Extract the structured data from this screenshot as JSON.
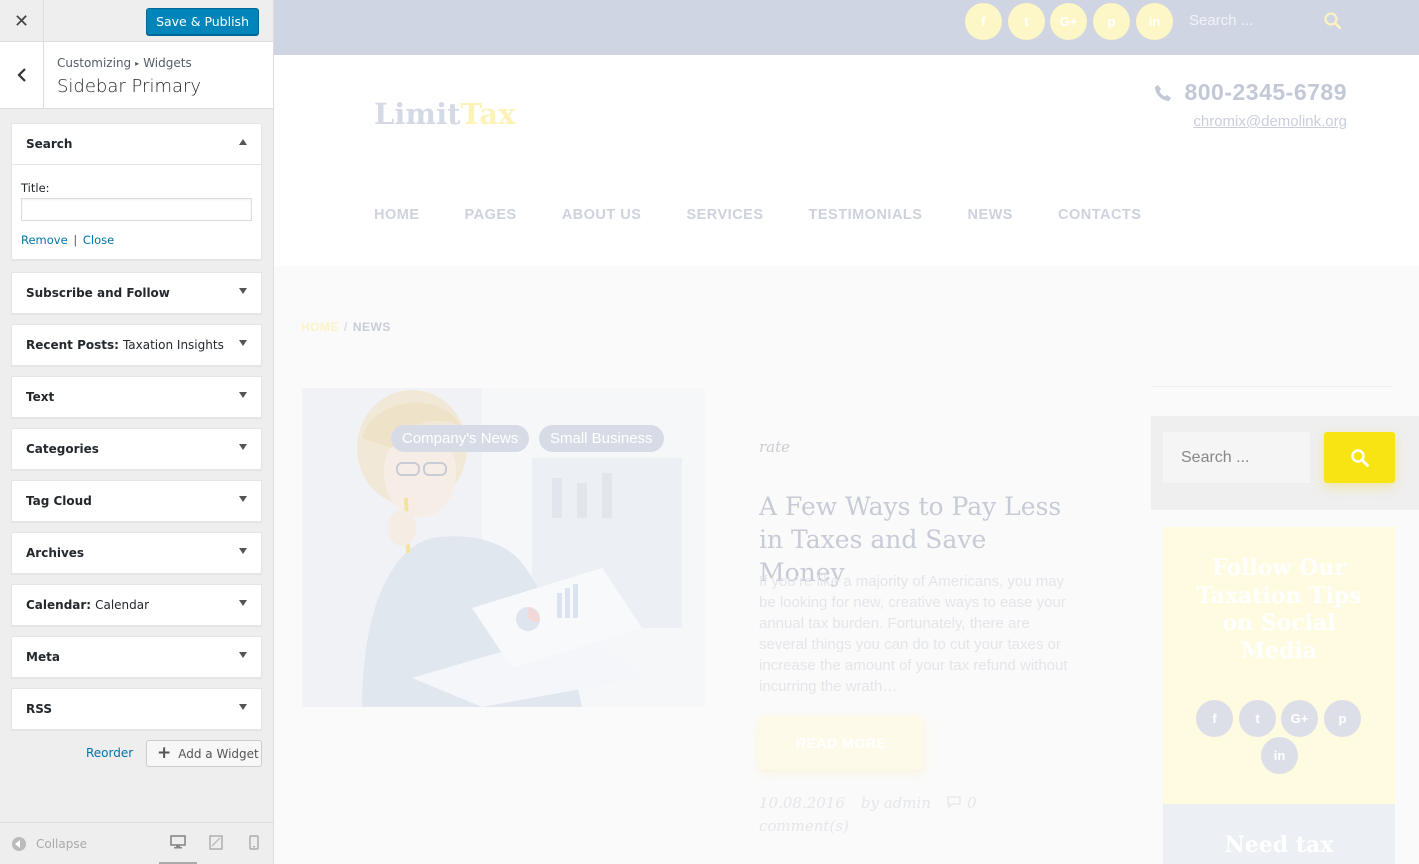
{
  "customizer": {
    "close_label": "✕",
    "save_label": "Save & Publish",
    "breadcrumb": {
      "root": "Customizing",
      "sep": "▸",
      "current": "Widgets"
    },
    "section_title": "Sidebar Primary",
    "widgets": [
      {
        "title": "Search",
        "sub": "",
        "expanded": true
      },
      {
        "title": "Subscribe and Follow",
        "sub": ""
      },
      {
        "title": "Recent Posts:",
        "sub": "Taxation Insights"
      },
      {
        "title": "Text",
        "sub": ""
      },
      {
        "title": "Categories",
        "sub": ""
      },
      {
        "title": "Tag Cloud",
        "sub": ""
      },
      {
        "title": "Archives",
        "sub": ""
      },
      {
        "title": "Calendar:",
        "sub": "Calendar"
      },
      {
        "title": "Meta",
        "sub": ""
      },
      {
        "title": "RSS",
        "sub": ""
      }
    ],
    "search_widget": {
      "title_label": "Title:",
      "title_value": "",
      "remove": "Remove",
      "pipe": "|",
      "close": "Close"
    },
    "reorder_label": "Reorder",
    "add_widget_label": "Add a Widget",
    "collapse_label": "Collapse",
    "devices": [
      "desktop-icon",
      "tablet-icon",
      "mobile-icon"
    ]
  },
  "site": {
    "topbar": {
      "social": [
        "f",
        "t",
        "G+",
        "p",
        "in"
      ],
      "search_placeholder": "Search ..."
    },
    "logo": {
      "part1": "Limit",
      "part2": "Tax"
    },
    "phone": "800-2345-6789",
    "email": "chromix@demolink.org",
    "nav": [
      "HOME",
      "PAGES",
      "ABOUT US",
      "SERVICES",
      "TESTIMONIALS",
      "NEWS",
      "CONTACTS"
    ],
    "breadcrumb": {
      "home": "HOME",
      "sep": "/",
      "current": "NEWS"
    },
    "post": {
      "tags": [
        "Company's News",
        "Small Business"
      ],
      "rate": "rate",
      "title": "A Few Ways to Pay Less in Taxes and Save Money",
      "excerpt": "If you’re like a majority of Americans, you may be looking for new, creative ways to ease your annual tax burden. Fortunately, there are several things you can do to cut your taxes or increase the amount of your tax refund without incurring the wrath…",
      "read_more": "READ MORE",
      "date": "10.08.2016",
      "author": "by admin",
      "comments": "0 comment(s)"
    },
    "sidebar": {
      "search_placeholder": "Search ...",
      "follow_title": "Follow Our Taxation Tips on Social Media",
      "follow_social": [
        "f",
        "t",
        "G+",
        "p",
        "in"
      ],
      "tax_title": "Need tax"
    },
    "colors": {
      "accent": "#f8e313",
      "topbar": "#cfd5e2",
      "wp_blue": "#0085ba"
    }
  }
}
